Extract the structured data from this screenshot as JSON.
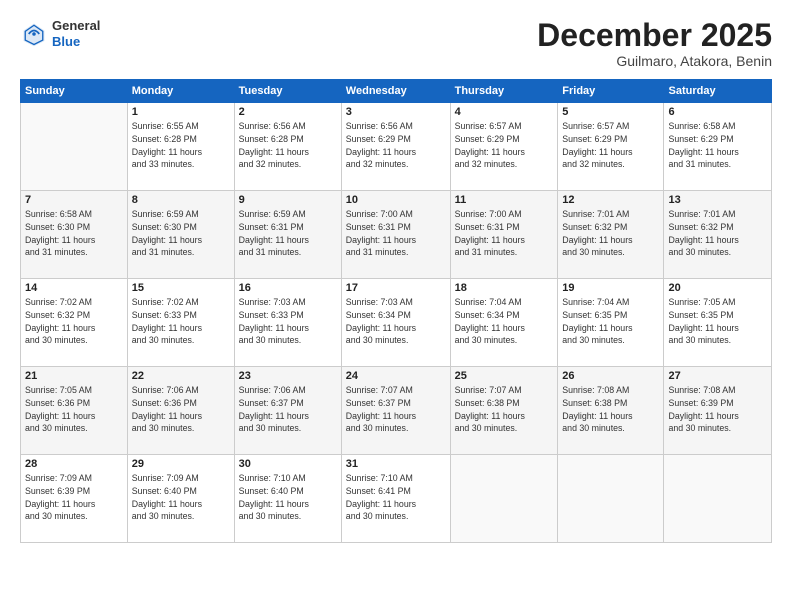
{
  "header": {
    "logo": {
      "line1": "General",
      "line2": "Blue"
    },
    "title": "December 2025",
    "location": "Guilmaro, Atakora, Benin"
  },
  "days_of_week": [
    "Sunday",
    "Monday",
    "Tuesday",
    "Wednesday",
    "Thursday",
    "Friday",
    "Saturday"
  ],
  "weeks": [
    [
      {
        "day": "",
        "info": ""
      },
      {
        "day": "1",
        "info": "Sunrise: 6:55 AM\nSunset: 6:28 PM\nDaylight: 11 hours\nand 33 minutes."
      },
      {
        "day": "2",
        "info": "Sunrise: 6:56 AM\nSunset: 6:28 PM\nDaylight: 11 hours\nand 32 minutes."
      },
      {
        "day": "3",
        "info": "Sunrise: 6:56 AM\nSunset: 6:29 PM\nDaylight: 11 hours\nand 32 minutes."
      },
      {
        "day": "4",
        "info": "Sunrise: 6:57 AM\nSunset: 6:29 PM\nDaylight: 11 hours\nand 32 minutes."
      },
      {
        "day": "5",
        "info": "Sunrise: 6:57 AM\nSunset: 6:29 PM\nDaylight: 11 hours\nand 32 minutes."
      },
      {
        "day": "6",
        "info": "Sunrise: 6:58 AM\nSunset: 6:29 PM\nDaylight: 11 hours\nand 31 minutes."
      }
    ],
    [
      {
        "day": "7",
        "info": "Sunrise: 6:58 AM\nSunset: 6:30 PM\nDaylight: 11 hours\nand 31 minutes."
      },
      {
        "day": "8",
        "info": "Sunrise: 6:59 AM\nSunset: 6:30 PM\nDaylight: 11 hours\nand 31 minutes."
      },
      {
        "day": "9",
        "info": "Sunrise: 6:59 AM\nSunset: 6:31 PM\nDaylight: 11 hours\nand 31 minutes."
      },
      {
        "day": "10",
        "info": "Sunrise: 7:00 AM\nSunset: 6:31 PM\nDaylight: 11 hours\nand 31 minutes."
      },
      {
        "day": "11",
        "info": "Sunrise: 7:00 AM\nSunset: 6:31 PM\nDaylight: 11 hours\nand 31 minutes."
      },
      {
        "day": "12",
        "info": "Sunrise: 7:01 AM\nSunset: 6:32 PM\nDaylight: 11 hours\nand 30 minutes."
      },
      {
        "day": "13",
        "info": "Sunrise: 7:01 AM\nSunset: 6:32 PM\nDaylight: 11 hours\nand 30 minutes."
      }
    ],
    [
      {
        "day": "14",
        "info": "Sunrise: 7:02 AM\nSunset: 6:32 PM\nDaylight: 11 hours\nand 30 minutes."
      },
      {
        "day": "15",
        "info": "Sunrise: 7:02 AM\nSunset: 6:33 PM\nDaylight: 11 hours\nand 30 minutes."
      },
      {
        "day": "16",
        "info": "Sunrise: 7:03 AM\nSunset: 6:33 PM\nDaylight: 11 hours\nand 30 minutes."
      },
      {
        "day": "17",
        "info": "Sunrise: 7:03 AM\nSunset: 6:34 PM\nDaylight: 11 hours\nand 30 minutes."
      },
      {
        "day": "18",
        "info": "Sunrise: 7:04 AM\nSunset: 6:34 PM\nDaylight: 11 hours\nand 30 minutes."
      },
      {
        "day": "19",
        "info": "Sunrise: 7:04 AM\nSunset: 6:35 PM\nDaylight: 11 hours\nand 30 minutes."
      },
      {
        "day": "20",
        "info": "Sunrise: 7:05 AM\nSunset: 6:35 PM\nDaylight: 11 hours\nand 30 minutes."
      }
    ],
    [
      {
        "day": "21",
        "info": "Sunrise: 7:05 AM\nSunset: 6:36 PM\nDaylight: 11 hours\nand 30 minutes."
      },
      {
        "day": "22",
        "info": "Sunrise: 7:06 AM\nSunset: 6:36 PM\nDaylight: 11 hours\nand 30 minutes."
      },
      {
        "day": "23",
        "info": "Sunrise: 7:06 AM\nSunset: 6:37 PM\nDaylight: 11 hours\nand 30 minutes."
      },
      {
        "day": "24",
        "info": "Sunrise: 7:07 AM\nSunset: 6:37 PM\nDaylight: 11 hours\nand 30 minutes."
      },
      {
        "day": "25",
        "info": "Sunrise: 7:07 AM\nSunset: 6:38 PM\nDaylight: 11 hours\nand 30 minutes."
      },
      {
        "day": "26",
        "info": "Sunrise: 7:08 AM\nSunset: 6:38 PM\nDaylight: 11 hours\nand 30 minutes."
      },
      {
        "day": "27",
        "info": "Sunrise: 7:08 AM\nSunset: 6:39 PM\nDaylight: 11 hours\nand 30 minutes."
      }
    ],
    [
      {
        "day": "28",
        "info": "Sunrise: 7:09 AM\nSunset: 6:39 PM\nDaylight: 11 hours\nand 30 minutes."
      },
      {
        "day": "29",
        "info": "Sunrise: 7:09 AM\nSunset: 6:40 PM\nDaylight: 11 hours\nand 30 minutes."
      },
      {
        "day": "30",
        "info": "Sunrise: 7:10 AM\nSunset: 6:40 PM\nDaylight: 11 hours\nand 30 minutes."
      },
      {
        "day": "31",
        "info": "Sunrise: 7:10 AM\nSunset: 6:41 PM\nDaylight: 11 hours\nand 30 minutes."
      },
      {
        "day": "",
        "info": ""
      },
      {
        "day": "",
        "info": ""
      },
      {
        "day": "",
        "info": ""
      }
    ]
  ]
}
